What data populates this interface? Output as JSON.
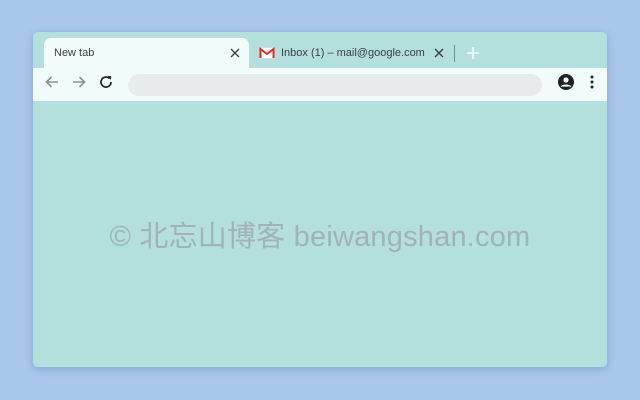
{
  "tabs": [
    {
      "title": "New tab",
      "active": true,
      "close_glyph": "✕"
    },
    {
      "title": "Inbox (1) – mail@google.com",
      "active": false,
      "icon": "gmail-icon",
      "close_glyph": "✕"
    }
  ],
  "new_tab_glyph": "+",
  "omnibox": {
    "value": "",
    "placeholder": ""
  },
  "icons": {
    "back": "arrow-back-icon",
    "forward": "arrow-forward-icon",
    "reload": "reload-icon",
    "account": "account-circle-icon",
    "menu": "more-vert-icon"
  },
  "watermark": {
    "text": "© 北忘山博客 beiwangshan.com"
  },
  "colors": {
    "desktop": "#a8c7ec",
    "frame": "#b3dfdc",
    "active_tab": "#f1fbfa",
    "toolbar": "#f1fbfa",
    "omnibox": "#e5eceb",
    "icon": "#3c4043",
    "gmail_red": "#d93025",
    "watermark": "#a2b3b7"
  }
}
